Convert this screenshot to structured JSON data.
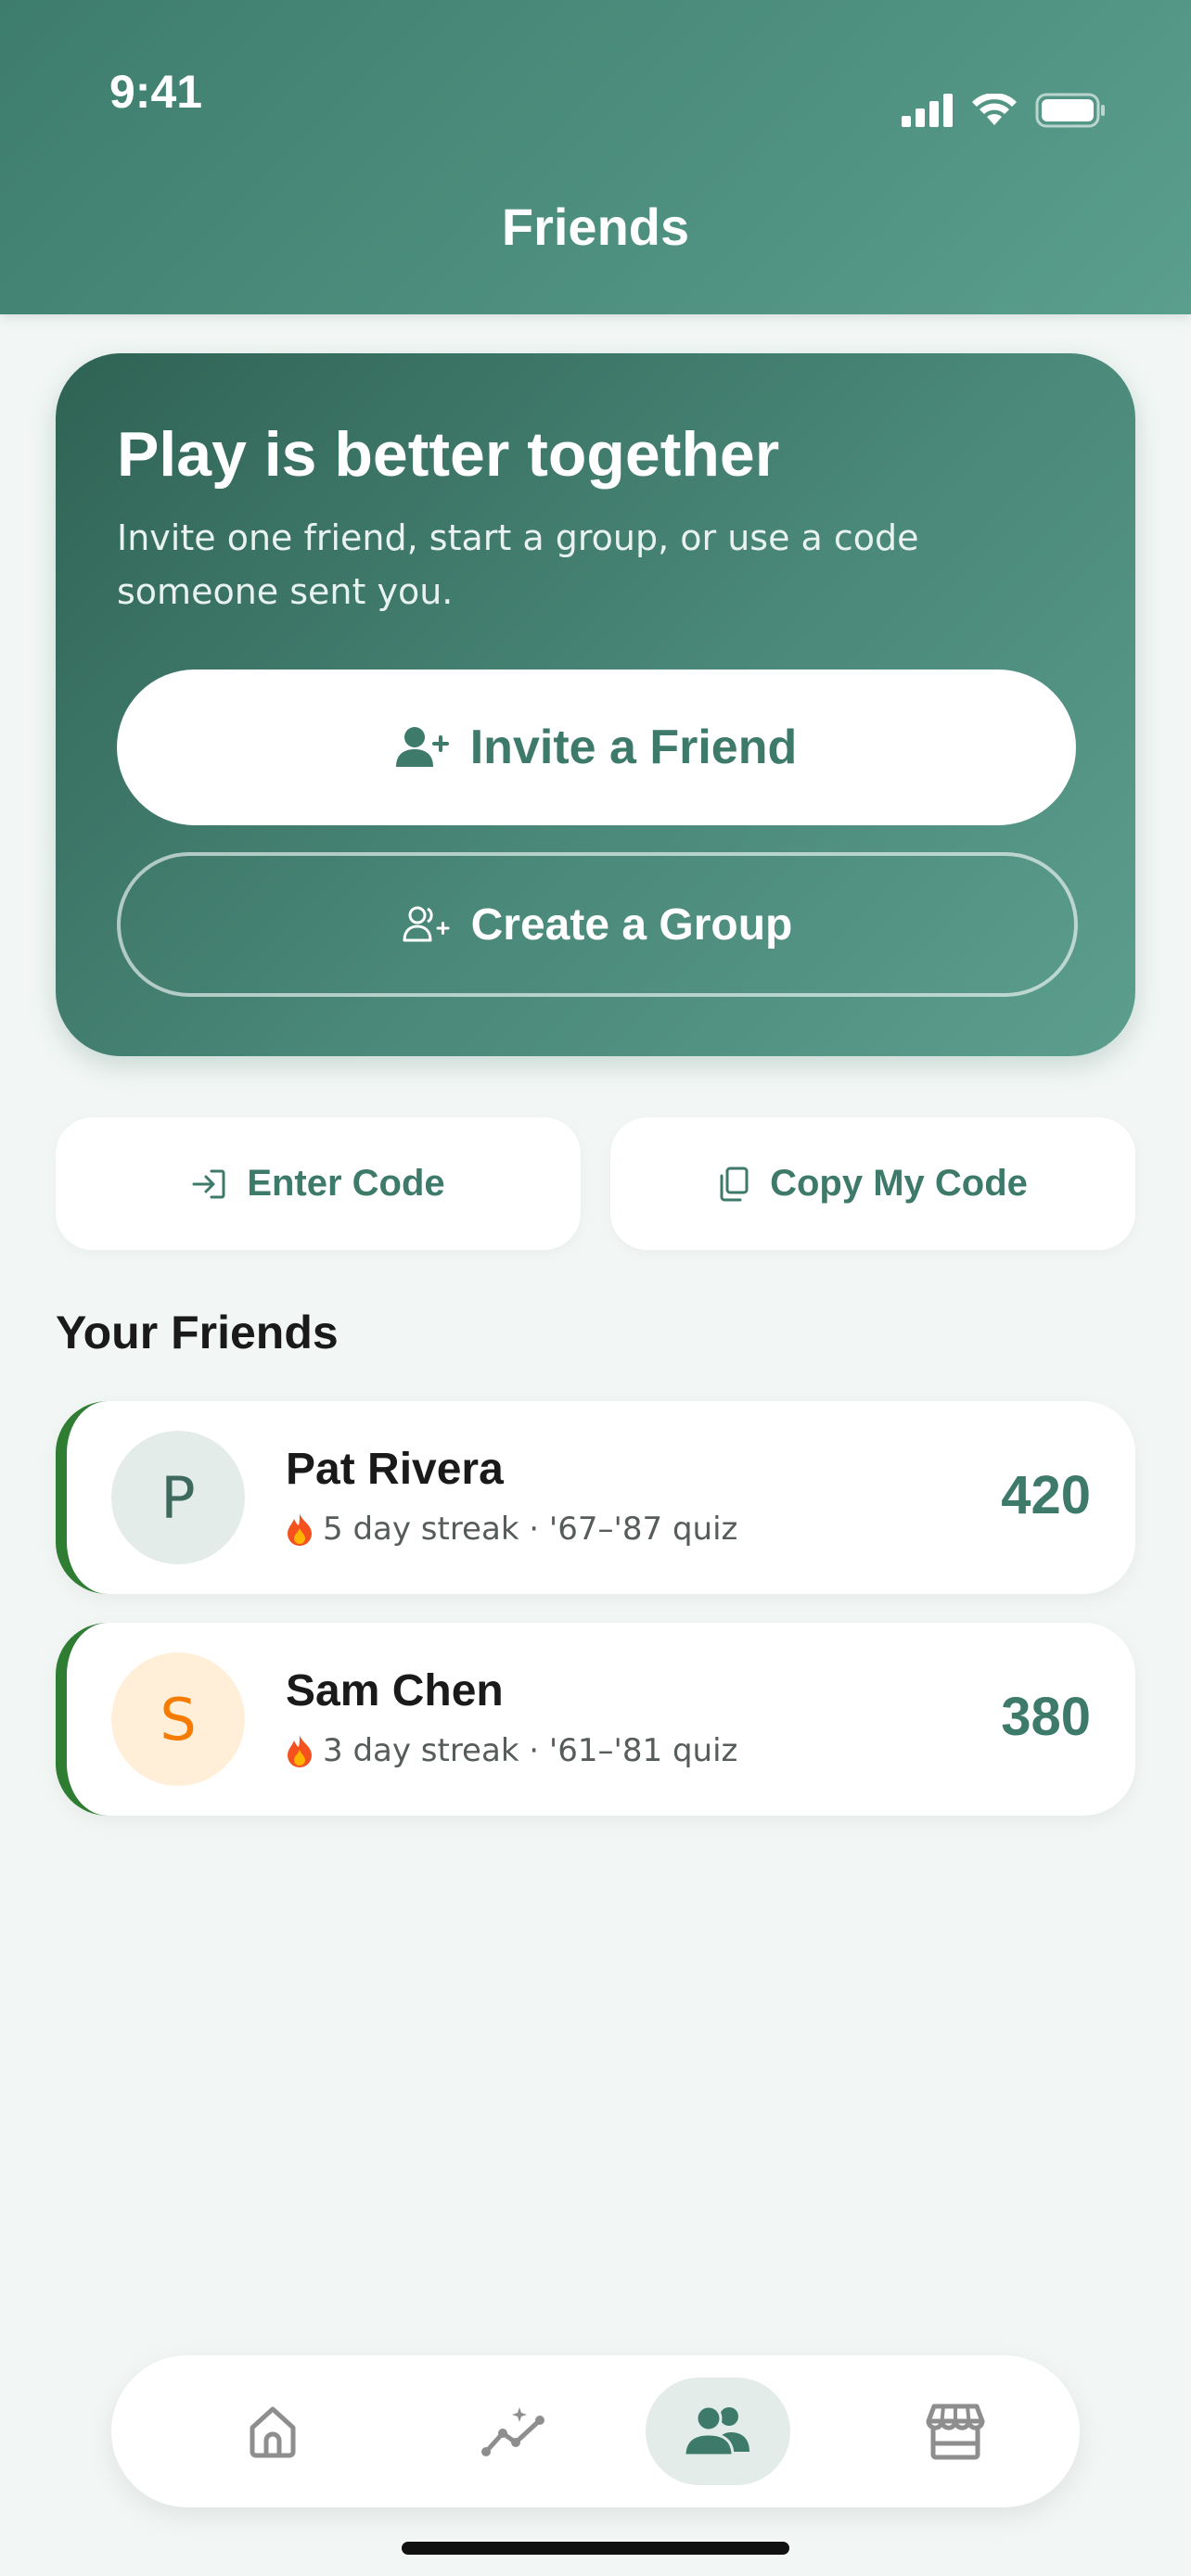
{
  "status_bar": {
    "time": "9:41"
  },
  "header": {
    "title": "Friends"
  },
  "hero": {
    "title": "Play is better together",
    "subtitle": "Invite one friend, start a group, or use a code someone sent you.",
    "invite_label": "Invite a Friend",
    "group_label": "Create a Group"
  },
  "actions": {
    "enter_code_label": "Enter Code",
    "copy_code_label": "Copy My Code"
  },
  "friends_section": {
    "title": "Your Friends",
    "friends": [
      {
        "initial": "P",
        "name": "Pat Rivera",
        "meta": "5 day streak · '67–'87 quiz",
        "score": "420"
      },
      {
        "initial": "S",
        "name": "Sam Chen",
        "meta": "3 day streak · '61–'81 quiz",
        "score": "380"
      }
    ]
  },
  "colors": {
    "accent": "#3e7a6a",
    "streak_border": "#2e7d32",
    "avatar_p_bg": "#e3ece9",
    "avatar_s_bg": "#ffefd9",
    "avatar_s_fg": "#f57c00"
  },
  "nav": {
    "items": [
      {
        "icon": "home-icon",
        "active": false
      },
      {
        "icon": "progress-icon",
        "active": false
      },
      {
        "icon": "friends-icon",
        "active": true
      },
      {
        "icon": "shop-icon",
        "active": false
      }
    ]
  }
}
